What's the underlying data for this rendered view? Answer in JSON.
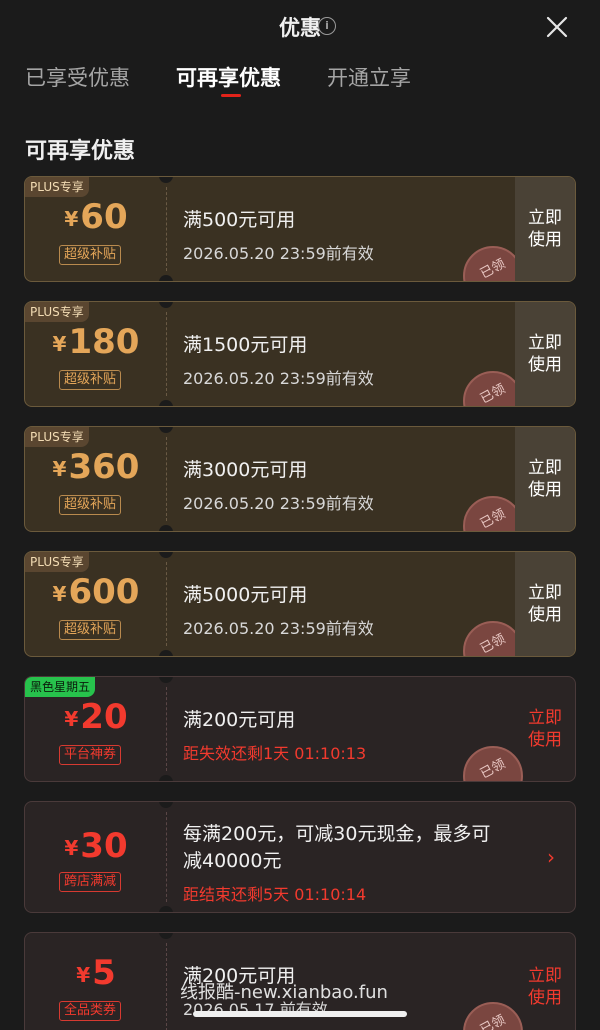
{
  "header": {
    "title": "优惠",
    "info_icon": "info-icon",
    "close_icon": "close-icon"
  },
  "tabs": [
    {
      "label": "已享受优惠",
      "active": false
    },
    {
      "label": "可再享优惠",
      "active": true
    },
    {
      "label": "开通立享",
      "active": false
    }
  ],
  "section_title": "可再享优惠",
  "colors": {
    "accent_red": "#f23a2e",
    "gold": "#e4a659",
    "green_tag": "#27c24c"
  },
  "coupons": [
    {
      "tag": "PLUS专享",
      "currency": "¥",
      "amount": "60",
      "badge": "超级补贴",
      "condition": "满500元可用",
      "validity": "2026.05.20 23:59前有效",
      "use_label": "立即使用",
      "stamp": "已领"
    },
    {
      "tag": "PLUS专享",
      "currency": "¥",
      "amount": "180",
      "badge": "超级补贴",
      "condition": "满1500元可用",
      "validity": "2026.05.20 23:59前有效",
      "use_label": "立即使用",
      "stamp": "已领"
    },
    {
      "tag": "PLUS专享",
      "currency": "¥",
      "amount": "360",
      "badge": "超级补贴",
      "condition": "满3000元可用",
      "validity": "2026.05.20 23:59前有效",
      "use_label": "立即使用",
      "stamp": "已领"
    },
    {
      "tag": "PLUS专享",
      "currency": "¥",
      "amount": "600",
      "badge": "超级补贴",
      "condition": "满5000元可用",
      "validity": "2026.05.20 23:59前有效",
      "use_label": "立即使用",
      "stamp": "已领"
    },
    {
      "tag": "黑色星期五",
      "currency": "¥",
      "amount": "20",
      "badge": "平台神券",
      "condition": "满200元可用",
      "validity": "距失效还剩1天 01:10:13",
      "use_label": "立即使用",
      "stamp": "已领"
    },
    {
      "currency": "¥",
      "amount": "30",
      "badge": "跨店满减",
      "condition_line1": "每满200元，可减30元现金，最多可",
      "condition_line2": "减40000元",
      "validity": "距结束还剩5天 01:10:14",
      "chevron": "chevron-right-icon"
    },
    {
      "currency": "¥",
      "amount": "5",
      "badge": "全品类券",
      "condition": "满200元可用",
      "validity": "2026.05.17 前有效",
      "use_label": "立即使用",
      "stamp": "已领"
    }
  ],
  "watermark": "线报酷-new.xianbao.fun"
}
